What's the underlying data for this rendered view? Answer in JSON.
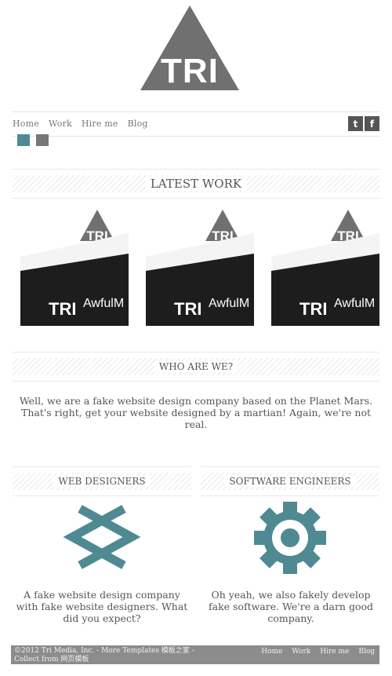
{
  "logo": {
    "text": "TRI"
  },
  "nav": {
    "items": [
      "Home",
      "Work",
      "Hire me",
      "Blog"
    ]
  },
  "social": {
    "twitter_glyph": "t",
    "facebook_glyph": "f"
  },
  "theme_swatches": [
    {
      "name": "teal",
      "color": "#4f8a93"
    },
    {
      "name": "gray",
      "color": "#777777"
    }
  ],
  "latest_work": {
    "title": "LATEST WORK",
    "items": [
      {
        "logo_text": "TRI",
        "site_text": "AwfulM"
      },
      {
        "logo_text": "TRI",
        "site_text": "AwfulM"
      },
      {
        "logo_text": "TRI",
        "site_text": "AwfulM"
      }
    ]
  },
  "who": {
    "title": "WHO ARE WE?",
    "text": "Well, we are a fake website design company based on the Planet Mars. That's right, get your website designed by a martian! Again, we're not real."
  },
  "web_designers": {
    "title": "WEB DESIGNERS",
    "text": "A fake website design company with fake website designers. What did you expect?"
  },
  "software_engineers": {
    "title": "SOFTWARE ENGINEERS",
    "text": "Oh yeah, we also fakely develop fake software. We're a darn good company."
  },
  "footer": {
    "copyright": "©2012 Tri Media, Inc. - More Templates 模板之家 - Collect from 网页模板",
    "links": [
      "Home",
      "Work",
      "Hire me",
      "Blog"
    ]
  },
  "colors": {
    "accent": "#4f8a93",
    "logo": "#707070",
    "footer_bg": "#8c8c8c"
  }
}
